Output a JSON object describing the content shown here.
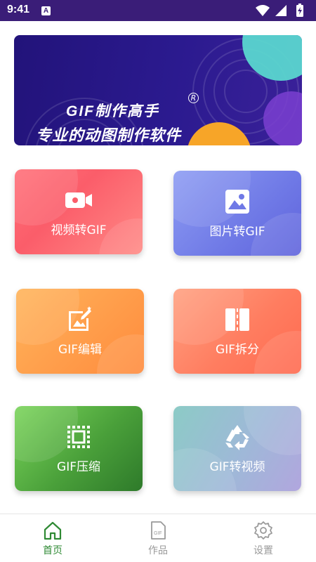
{
  "status_bar": {
    "time": "9:41",
    "notification_icon": "a-letter-icon",
    "icons": [
      "wifi-icon",
      "signal-icon",
      "battery-charging-icon"
    ]
  },
  "banner": {
    "title": "GIF制作高手",
    "registered_mark": "R",
    "subtitle": "专业的动图制作软件",
    "colors": {
      "background": "#22137a",
      "orange_circle": "#f7a528",
      "teal_circle": "#5ad6cf",
      "purple_circle": "#7a3fd0"
    }
  },
  "features": [
    {
      "label": "视频转GIF",
      "icon": "video-camera-icon"
    },
    {
      "label": "图片转GIF",
      "icon": "image-icon"
    },
    {
      "label": "GIF编辑",
      "icon": "image-edit-icon"
    },
    {
      "label": "GIF拆分",
      "icon": "split-icon"
    },
    {
      "label": "GIF压缩",
      "icon": "compress-icon"
    },
    {
      "label": "GIF转视频",
      "icon": "recycle-icon"
    }
  ],
  "bottom_nav": {
    "items": [
      {
        "label": "首页",
        "icon": "home-icon",
        "active": true
      },
      {
        "label": "作品",
        "icon": "gif-file-icon",
        "active": false
      },
      {
        "label": "设置",
        "icon": "gear-icon",
        "active": false
      }
    ],
    "active_color": "#2f8a34",
    "inactive_color": "#9a9a9a"
  }
}
